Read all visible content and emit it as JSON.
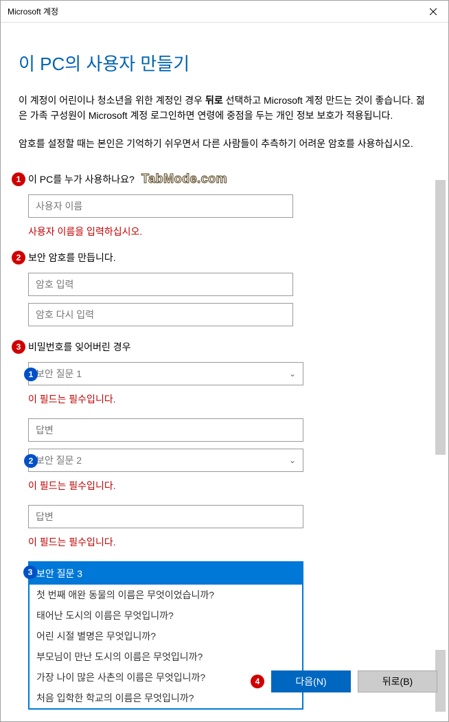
{
  "window": {
    "title": "Microsoft 계정"
  },
  "page": {
    "title": "이 PC의 사용자 만들기",
    "paragraph1_a": "이 계정이 어린이나 청소년을 위한 계정인 경우 ",
    "paragraph1_bold": "뒤로",
    "paragraph1_b": " 선택하고 Microsoft 계정 만드는 것이 좋습니다. 젊은 가족 구성원이 Microsoft 계정 로그인하면 연령에 중점을 두는 개인 정보 보호가 적용됩니다.",
    "paragraph2": "암호를 설정할 때는 본인은 기억하기 쉬우면서 다른 사람들이 추측하기 어려운 암호를 사용하십시오.",
    "watermark": "TabMode.com"
  },
  "section1": {
    "label": "이 PC를 누가 사용하나요?",
    "username_placeholder": "사용자 이름",
    "username_error": "사용자 이름을 입력하십시오."
  },
  "section2": {
    "label": "보안 암호를 만듭니다.",
    "password_placeholder": "암호 입력",
    "confirm_placeholder": "암호 다시 입력"
  },
  "section3": {
    "label": "비밀번호를 잊어버린 경우",
    "q1_placeholder": "보안 질문 1",
    "q1_error": "이 필드는 필수입니다.",
    "a1_placeholder": "답변",
    "q2_placeholder": "보안 질문 2",
    "q2_error": "이 필드는 필수입니다.",
    "a2_placeholder": "답변",
    "a2_error": "이 필드는 필수입니다.",
    "q3_selected": "보안 질문 3",
    "q3_options": {
      "o1": "첫 번째 애완 동물의 이름은 무엇이었습니까?",
      "o2": "태어난 도시의 이름은 무엇입니까?",
      "o3": "어린 시절 별명은 무엇입니까?",
      "o4": "부모님이 만난 도시의 이름은 무엇입니까?",
      "o5": "가장 나이 많은 사촌의 이름은 무엇입니까?",
      "o6": "처음 입학한 학교의 이름은 무엇입니까?"
    }
  },
  "buttons": {
    "next": "다음(N)",
    "back": "뒤로(B)"
  },
  "badges": {
    "n1": "1",
    "n2": "2",
    "n3": "3",
    "n4": "4",
    "b1": "1",
    "b2": "2",
    "b3": "3"
  }
}
